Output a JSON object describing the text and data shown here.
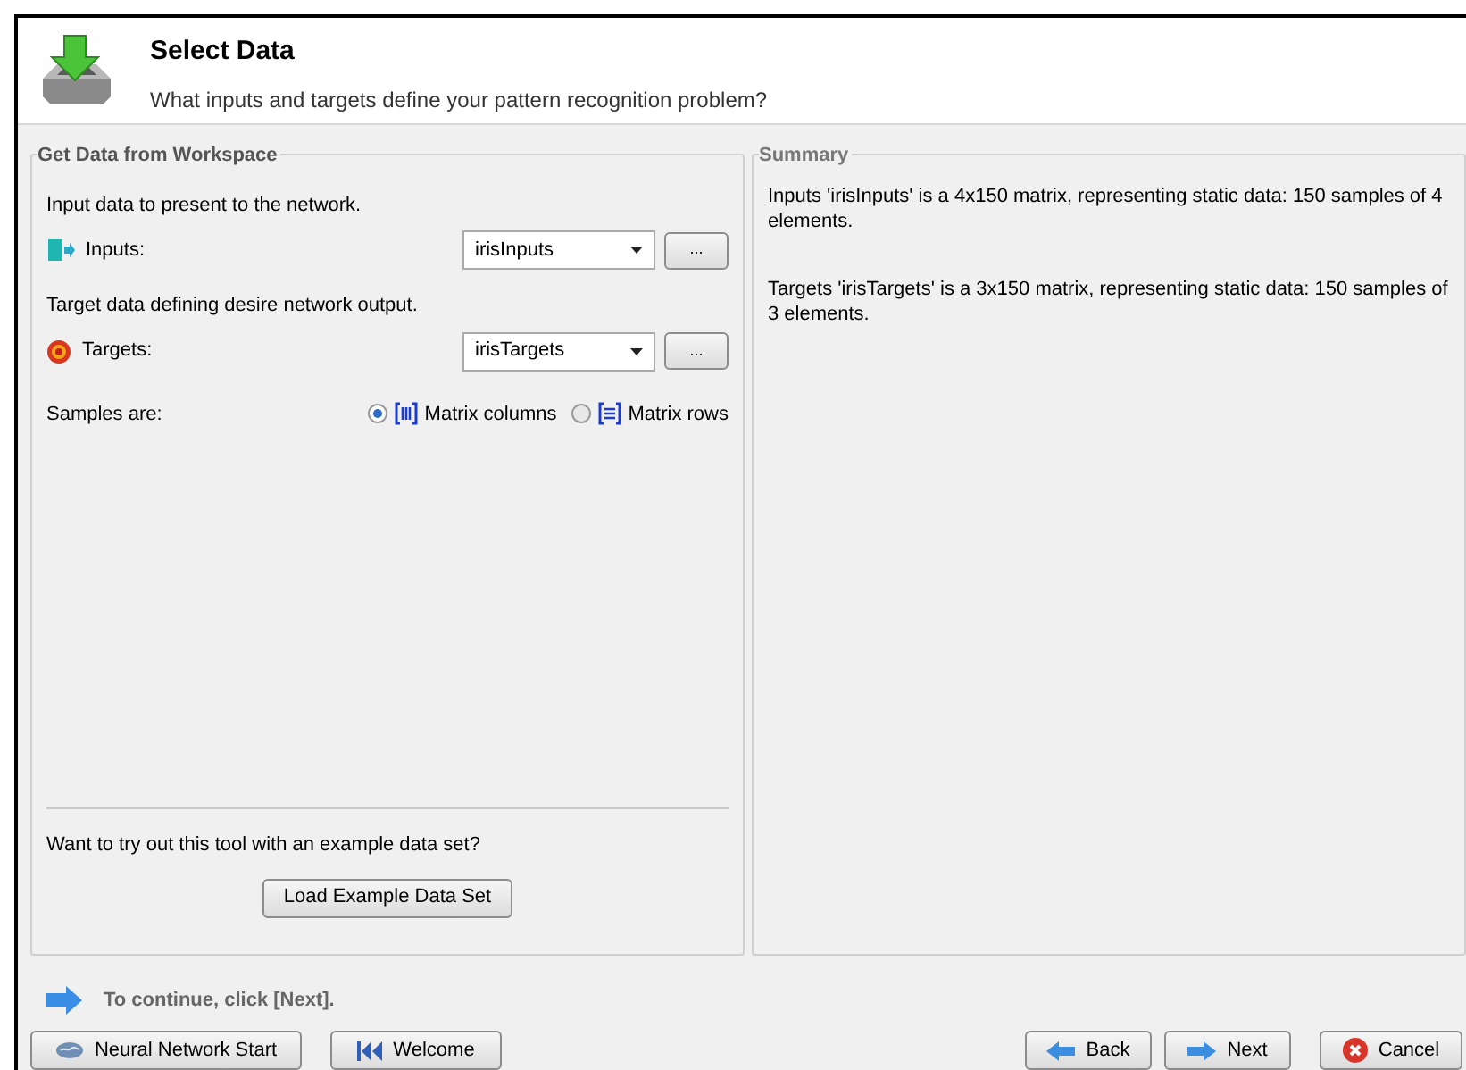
{
  "header": {
    "title": "Select Data",
    "subtitle": "What inputs and targets define your pattern recognition problem?"
  },
  "workspace": {
    "title": "Get Data from Workspace",
    "fields": [
      {
        "kind": "inputs",
        "hint": "Input data to present to the network.",
        "label": "Inputs:",
        "value": "irisInputs",
        "browse": "..."
      },
      {
        "kind": "targets",
        "hint": "Target data defining desire network output.",
        "label": "Targets:",
        "value": "irisTargets",
        "browse": "..."
      }
    ],
    "samples_label": "Samples are:",
    "samples_options": [
      {
        "kind": "columns",
        "label": "Matrix columns",
        "selected": true
      },
      {
        "kind": "rows",
        "label": "Matrix rows",
        "selected": false
      }
    ],
    "example_prompt": "Want to try out this tool with an example data set?",
    "example_button": "Load Example Data Set"
  },
  "summary": {
    "title": "Summary",
    "lines": [
      "Inputs 'irisInputs' is a 4x150 matrix, representing static data: 150 samples of 4 elements.",
      "Targets 'irisTargets' is a 3x150 matrix, representing static data: 150 samples of 3 elements."
    ]
  },
  "hint": "To continue, click [Next].",
  "left_buttons": [
    {
      "kind": "start",
      "label": "Neural Network Start"
    },
    {
      "kind": "welcome",
      "label": "Welcome"
    }
  ],
  "right_buttons": [
    {
      "kind": "back",
      "label": "Back"
    },
    {
      "kind": "next",
      "label": "Next"
    },
    {
      "kind": "cancel",
      "label": "Cancel"
    }
  ]
}
